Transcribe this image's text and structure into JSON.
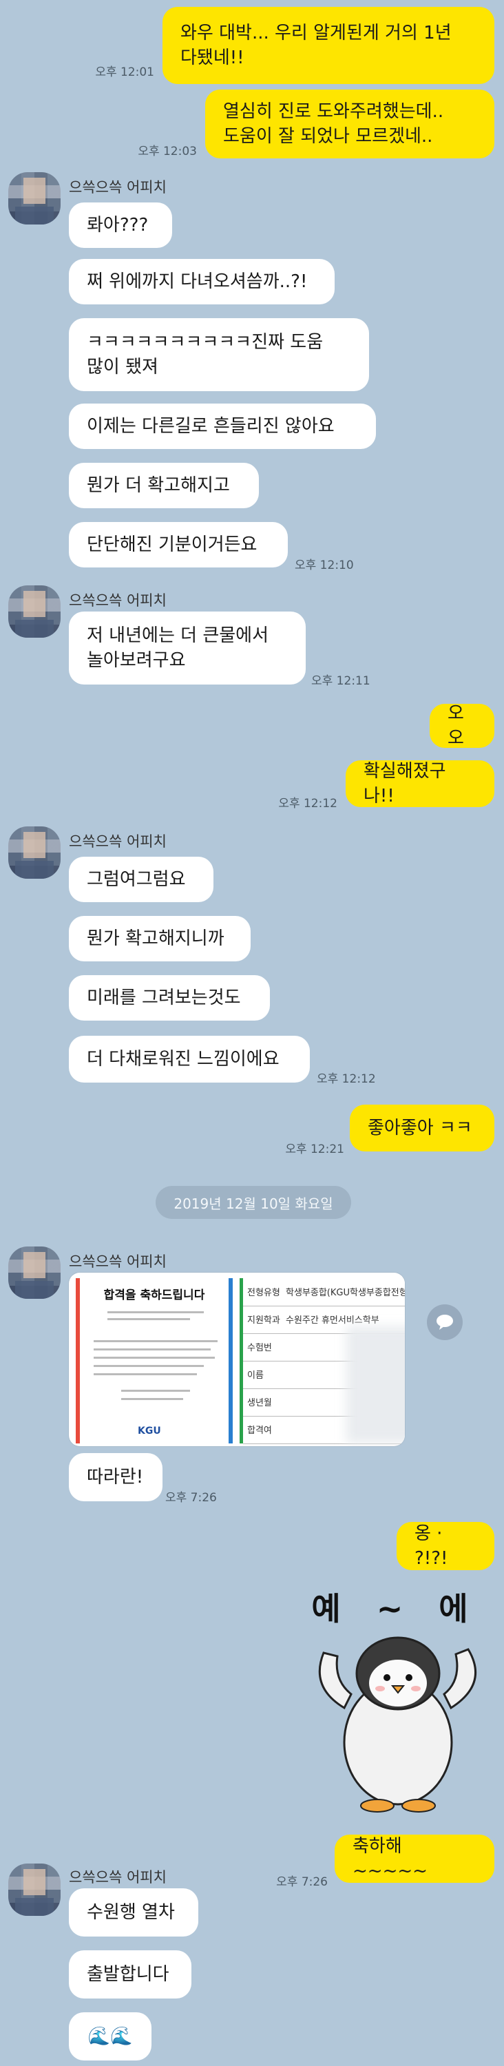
{
  "sender_name": "으쓱으쓱 어피치",
  "date_divider": "2019년 12월 10일 화요일",
  "messages": {
    "m1": "와우 대박... 우리 알게된게 거의 1년\n다됐네!!",
    "t1": "오후 12:01",
    "m2": "열심히 진로 도와주려했는데..\n도움이 잘 되었나 모르겠네..",
    "t2": "오후 12:03",
    "o1": "롸아???",
    "o2": "쩌 위에까지 다녀오셔씀까..?!",
    "o3": "ㅋㅋㅋㅋㅋㅋㅋㅋㅋㅋ진짜 도움\n많이 됐져",
    "o4": "이제는 다른길로 흔들리진 않아요",
    "o5": "뭔가 더 확고해지고",
    "o6": "단단해진 기분이거든요",
    "t3": "오후 12:10",
    "o7": "저 내년에는 더 큰물에서\n놀아보려구요",
    "t4": "오후 12:11",
    "m3": "오오",
    "m4": "확실해졌구나!!",
    "t5": "오후 12:12",
    "o8": "그럼여그럼요",
    "o9": "뭔가 확고해지니까",
    "o10": "미래를 그려보는것도",
    "o11": "더 다채로워진 느낌이에요",
    "t6": "오후 12:12",
    "m5": "좋아좋아 ㅋㅋ",
    "t7": "오후 12:21",
    "o12": "따라란!",
    "t8": "오후 7:26",
    "m6": "옹 · ?!?!",
    "sticker_text": "예 ~ 에",
    "m7": "축하해~~~~~",
    "t9": "오후 7:26",
    "o13": "수원행 열차",
    "o14": "출발합니다",
    "o15": "🌊🌊"
  },
  "photo": {
    "cert_title": "합격을 축하드립니다",
    "logo": "KGU",
    "rows": [
      {
        "label": "전형유형",
        "value": "학생부종합(KGU학생부종합전형)"
      },
      {
        "label": "지원학과",
        "value": "수원주간 휴먼서비스학부"
      },
      {
        "label": "수험번",
        "value": ""
      },
      {
        "label": "이름",
        "value": ""
      },
      {
        "label": "생년월",
        "value": ""
      },
      {
        "label": "합격여",
        "value": ""
      }
    ]
  },
  "colors": {
    "background": "#b2c7d9",
    "my_bubble": "#fee500",
    "other_bubble": "#ffffff"
  }
}
